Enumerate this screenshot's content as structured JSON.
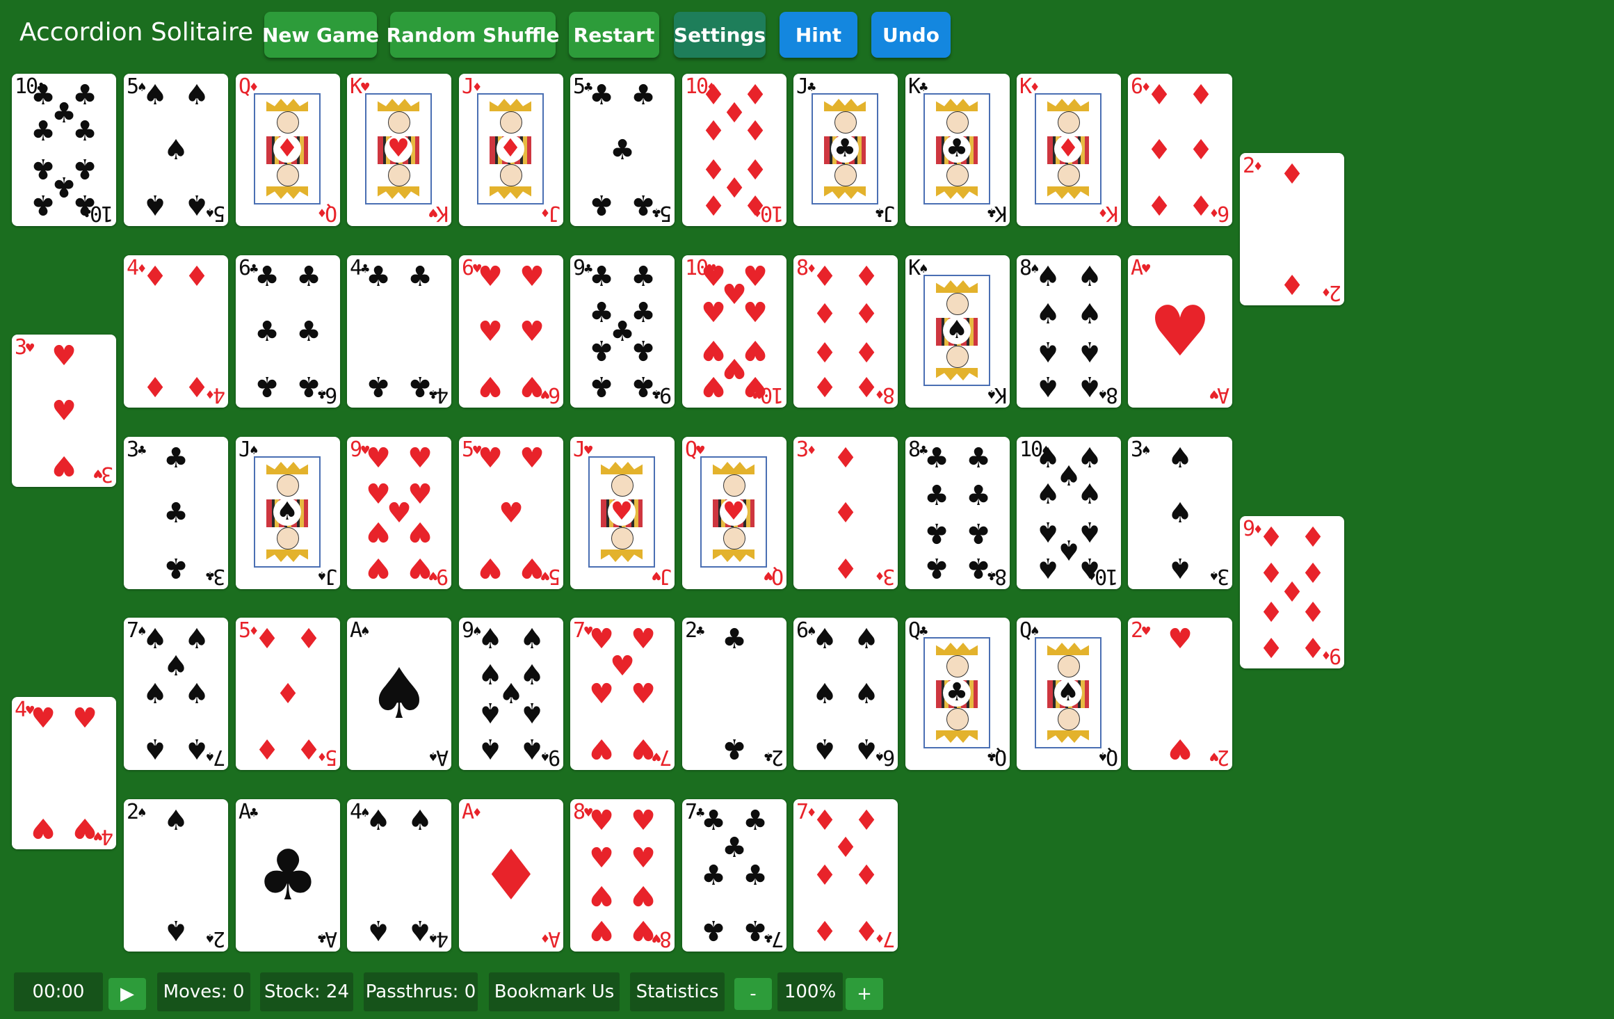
{
  "app": {
    "title": "Accordion Solitaire"
  },
  "toolbar": [
    {
      "id": "new-game",
      "label": "New Game",
      "color": "#2d9c3a"
    },
    {
      "id": "random-shuffle",
      "label": "Random Shuffle",
      "color": "#2d9c3a"
    },
    {
      "id": "restart",
      "label": "Restart",
      "color": "#2d9c3a"
    },
    {
      "id": "settings",
      "label": "Settings",
      "color": "#1e7e5a"
    },
    {
      "id": "hint",
      "label": "Hint",
      "color": "#1487df"
    },
    {
      "id": "undo",
      "label": "Undo",
      "color": "#1487df"
    }
  ],
  "tableau": [
    {
      "rank": "10",
      "suit": "clubs"
    },
    {
      "rank": "5",
      "suit": "spades"
    },
    {
      "rank": "Q",
      "suit": "diamonds"
    },
    {
      "rank": "K",
      "suit": "hearts"
    },
    {
      "rank": "J",
      "suit": "diamonds"
    },
    {
      "rank": "5",
      "suit": "clubs"
    },
    {
      "rank": "10",
      "suit": "diamonds"
    },
    {
      "rank": "J",
      "suit": "clubs"
    },
    {
      "rank": "K",
      "suit": "clubs"
    },
    {
      "rank": "K",
      "suit": "diamonds"
    },
    {
      "rank": "6",
      "suit": "diamonds"
    },
    {
      "rank": "2",
      "suit": "diamonds"
    },
    {
      "rank": "4",
      "suit": "diamonds"
    },
    {
      "rank": "6",
      "suit": "clubs"
    },
    {
      "rank": "4",
      "suit": "clubs"
    },
    {
      "rank": "6",
      "suit": "hearts"
    },
    {
      "rank": "9",
      "suit": "clubs"
    },
    {
      "rank": "10",
      "suit": "hearts"
    },
    {
      "rank": "8",
      "suit": "diamonds"
    },
    {
      "rank": "K",
      "suit": "spades"
    },
    {
      "rank": "8",
      "suit": "spades"
    },
    {
      "rank": "A",
      "suit": "hearts"
    },
    {
      "rank": "3",
      "suit": "hearts"
    },
    {
      "rank": "3",
      "suit": "clubs"
    },
    {
      "rank": "J",
      "suit": "spades"
    },
    {
      "rank": "9",
      "suit": "hearts"
    },
    {
      "rank": "5",
      "suit": "hearts"
    },
    {
      "rank": "J",
      "suit": "hearts"
    },
    {
      "rank": "Q",
      "suit": "hearts"
    },
    {
      "rank": "3",
      "suit": "diamonds"
    },
    {
      "rank": "8",
      "suit": "clubs"
    },
    {
      "rank": "10",
      "suit": "spades"
    },
    {
      "rank": "3",
      "suit": "spades"
    },
    {
      "rank": "9",
      "suit": "diamonds"
    },
    {
      "rank": "7",
      "suit": "spades"
    },
    {
      "rank": "5",
      "suit": "diamonds"
    },
    {
      "rank": "A",
      "suit": "spades"
    },
    {
      "rank": "9",
      "suit": "spades"
    },
    {
      "rank": "7",
      "suit": "hearts"
    },
    {
      "rank": "2",
      "suit": "clubs"
    },
    {
      "rank": "6",
      "suit": "spades"
    },
    {
      "rank": "Q",
      "suit": "clubs"
    },
    {
      "rank": "Q",
      "suit": "spades"
    },
    {
      "rank": "2",
      "suit": "hearts"
    },
    {
      "rank": "4",
      "suit": "hearts"
    },
    {
      "rank": "2",
      "suit": "spades"
    },
    {
      "rank": "A",
      "suit": "clubs"
    },
    {
      "rank": "4",
      "suit": "spades"
    },
    {
      "rank": "A",
      "suit": "diamonds"
    },
    {
      "rank": "8",
      "suit": "hearts"
    },
    {
      "rank": "7",
      "suit": "clubs"
    },
    {
      "rank": "7",
      "suit": "diamonds"
    }
  ],
  "suit_symbols": {
    "clubs": "♣",
    "spades": "♠",
    "hearts": "♥",
    "diamonds": "♦"
  },
  "colors": {
    "felt": "#1b6e1f",
    "red_suit": "#e8232a",
    "black_suit": "#0d0d0d",
    "footer_box": "#16531a"
  },
  "footer": {
    "timer": "00:00",
    "play_icon": "▶",
    "moves": "Moves: 0",
    "stock": "Stock: 24",
    "passthrus": "Passthrus: 0",
    "bookmark": "Bookmark Us",
    "statistics": "Statistics",
    "zoom_out": "-",
    "zoom": "100%",
    "zoom_in": "+"
  }
}
